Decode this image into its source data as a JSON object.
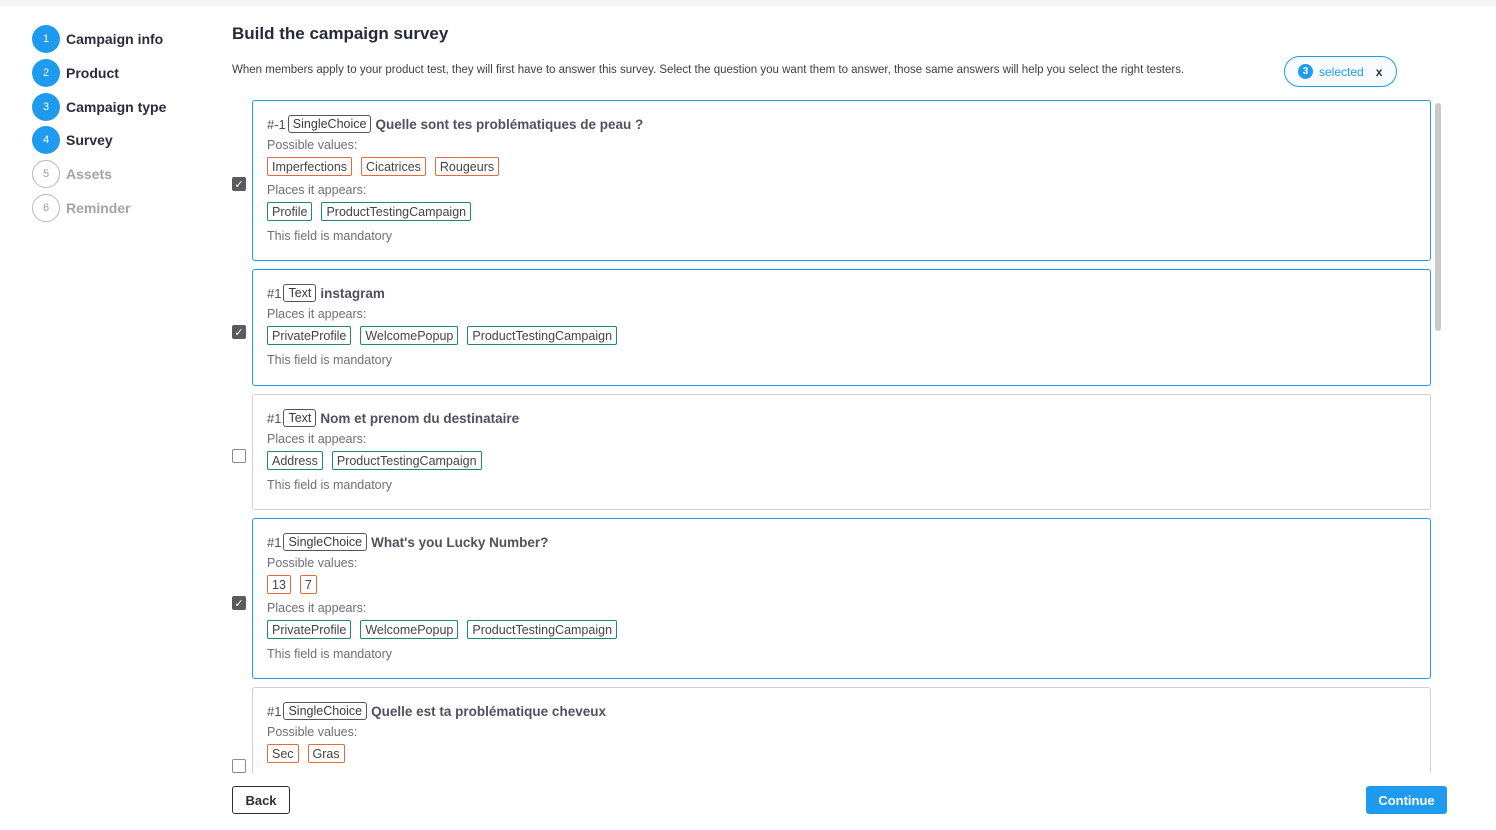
{
  "steps": [
    {
      "number": "1",
      "label": "Campaign info",
      "status": "done"
    },
    {
      "number": "2",
      "label": "Product",
      "status": "done"
    },
    {
      "number": "3",
      "label": "Campaign type",
      "status": "done"
    },
    {
      "number": "4",
      "label": "Survey",
      "status": "done"
    },
    {
      "number": "5",
      "label": "Assets",
      "status": "todo"
    },
    {
      "number": "6",
      "label": "Reminder",
      "status": "todo"
    }
  ],
  "page": {
    "title": "Build the campaign survey",
    "intro": "When members apply to your product test, they will first have to answer this survey. Select the question you want them to answer, those same answers will help you select the right testers."
  },
  "selection": {
    "count": "3",
    "label": "selected",
    "clear": "x"
  },
  "labels": {
    "possible_values": "Possible values:",
    "places": "Places it appears:",
    "mandatory": "This field is mandatory"
  },
  "questions": [
    {
      "number": "#-1",
      "type": "SingleChoice",
      "title": "Quelle sont tes problématiques de peau ?",
      "checked": true,
      "values": [
        "Imperfections",
        "Cicatrices",
        "Rougeurs"
      ],
      "places": [
        "Profile",
        "ProductTestingCampaign"
      ],
      "mandatory": true
    },
    {
      "number": "#1",
      "type": "Text",
      "title": "instagram",
      "checked": true,
      "values": [],
      "places": [
        "PrivateProfile",
        "WelcomePopup",
        "ProductTestingCampaign"
      ],
      "mandatory": true
    },
    {
      "number": "#1",
      "type": "Text",
      "title": "Nom et prenom du destinataire",
      "checked": false,
      "values": [],
      "places": [
        "Address",
        "ProductTestingCampaign"
      ],
      "mandatory": true
    },
    {
      "number": "#1",
      "type": "SingleChoice",
      "title": "What's you Lucky Number?",
      "checked": true,
      "values": [
        "13",
        "7"
      ],
      "places": [
        "PrivateProfile",
        "WelcomePopup",
        "ProductTestingCampaign"
      ],
      "mandatory": true
    },
    {
      "number": "#1",
      "type": "SingleChoice",
      "title": "Quelle est ta problématique cheveux",
      "checked": false,
      "values": [
        "Sec",
        "Gras"
      ],
      "places": [],
      "mandatory": false
    }
  ],
  "buttons": {
    "back": "Back",
    "continue": "Continue"
  }
}
